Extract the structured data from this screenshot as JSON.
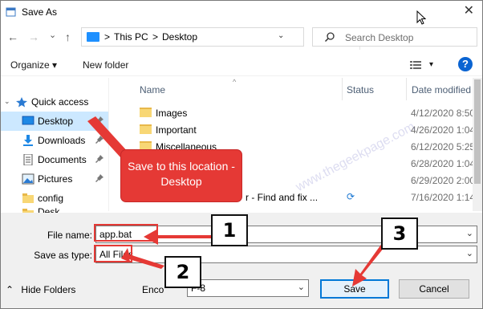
{
  "window": {
    "title": "Save As",
    "close_glyph": "✕"
  },
  "nav": {
    "back_glyph": "←",
    "forward_glyph": "→",
    "recent_glyph": "⌄",
    "up_glyph": "↑",
    "breadcrumb": [
      "This PC",
      "Desktop"
    ],
    "breadcrumb_sep": ">",
    "address_dropdown_glyph": "⌄",
    "refresh_glyph": "↻",
    "search_placeholder": "Search Desktop"
  },
  "toolbar": {
    "organize_label": "Organize ▾",
    "new_folder_label": "New folder",
    "help_label": "?",
    "view_dropdown_glyph": "▾"
  },
  "sidebar": {
    "items": [
      {
        "label": "Quick access",
        "icon": "star-icon",
        "expanded_glyph": "⌄"
      },
      {
        "label": "Desktop",
        "icon": "desktop-icon",
        "pinned": true,
        "selected": true
      },
      {
        "label": "Downloads",
        "icon": "download-icon",
        "pinned": true
      },
      {
        "label": "Documents",
        "icon": "documents-icon",
        "pinned": true
      },
      {
        "label": "Pictures",
        "icon": "pictures-icon",
        "pinned": true
      },
      {
        "label": "config",
        "icon": "folder-icon"
      },
      {
        "label": "Desk",
        "icon": "folder-icon"
      }
    ]
  },
  "filelist": {
    "columns": [
      "Name",
      "Status",
      "Date modified"
    ],
    "rows": [
      {
        "name": "Images",
        "date": "4/12/2020 8:50"
      },
      {
        "name": "Important",
        "date": "4/26/2020 1:04"
      },
      {
        "name": "Miscellaneous",
        "date": "6/12/2020 5:25"
      },
      {
        "name": "",
        "date": "6/28/2020 1:04"
      },
      {
        "name": "",
        "date": "6/29/2020 2:00"
      },
      {
        "name": "r - Find and fix ...",
        "status_glyph": "⟳",
        "date": "7/16/2020 1:14"
      }
    ],
    "watermark": "www.thegeekpage.com"
  },
  "form": {
    "file_name_label": "File name:",
    "file_name_value": "app.bat",
    "save_as_type_label": "Save as type:",
    "save_as_type_value": "All Files",
    "encoding_label": "Enco",
    "encoding_value": "F-8",
    "dropdown_glyph": "⌄"
  },
  "footer": {
    "hide_folders_label": "Hide Folders",
    "hide_folders_glyph": "⌃",
    "save_label": "Save",
    "cancel_label": "Cancel"
  },
  "annotations": {
    "callout_text": "Save to this location - Desktop",
    "step1": "1",
    "step2": "2",
    "step3": "3",
    "accent_color": "#e53935"
  }
}
